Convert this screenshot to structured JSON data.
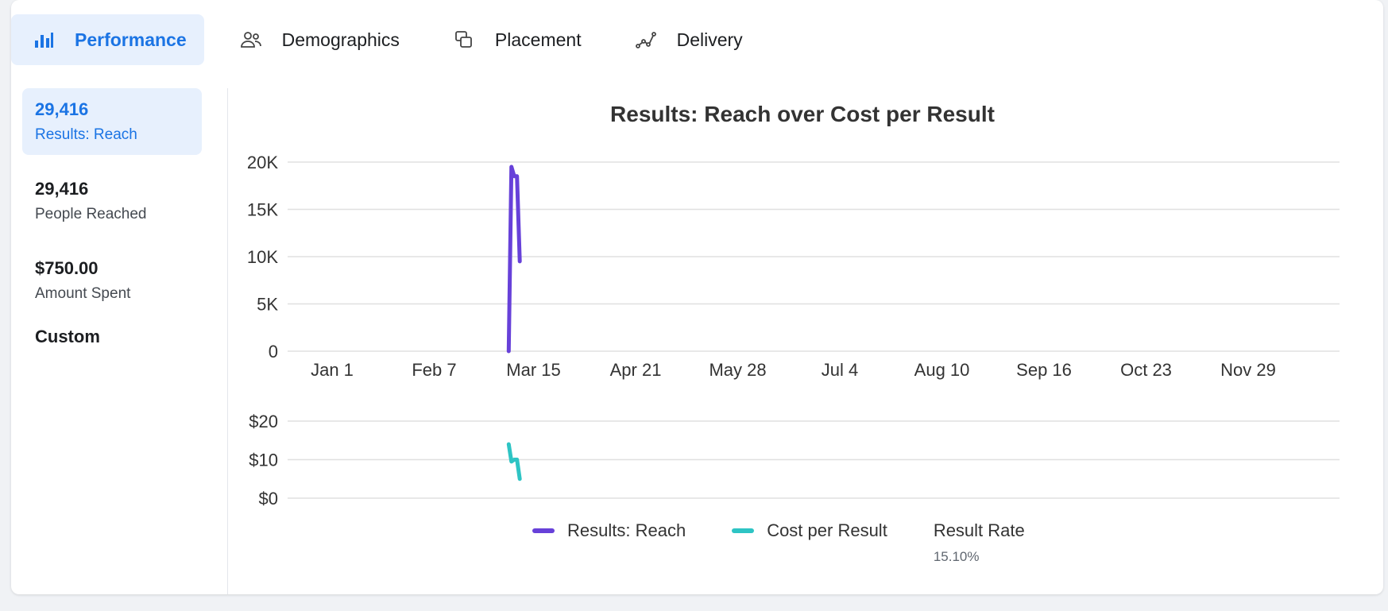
{
  "tabs": [
    {
      "label": "Performance",
      "icon": "bar-chart-icon",
      "active": true
    },
    {
      "label": "Demographics",
      "icon": "people-icon",
      "active": false
    },
    {
      "label": "Placement",
      "icon": "placement-icon",
      "active": false
    },
    {
      "label": "Delivery",
      "icon": "delivery-icon",
      "active": false
    }
  ],
  "metrics": [
    {
      "value": "29,416",
      "label": "Results: Reach",
      "active": true
    },
    {
      "value": "29,416",
      "label": "People Reached",
      "active": false
    },
    {
      "value": "$750.00",
      "label": "Amount Spent",
      "active": false
    }
  ],
  "custom_label": "Custom",
  "legend": {
    "reach_label": "Results: Reach",
    "cost_label": "Cost per Result",
    "rate_label": "Result Rate",
    "rate_value": "15.10%"
  },
  "colors": {
    "accent": "#1b74e4",
    "reach": "#6741d9",
    "cost": "#2ec4c4"
  },
  "chart_data": [
    {
      "type": "line",
      "title": "Results: Reach over Cost per Result",
      "x_ticks": [
        "Jan 1",
        "Feb 7",
        "Mar 15",
        "Apr 21",
        "May 28",
        "Jul 4",
        "Aug 10",
        "Sep 16",
        "Oct 23",
        "Nov 29"
      ],
      "y_ticks": [
        "0",
        "5K",
        "10K",
        "15K",
        "20K"
      ],
      "ylim": [
        0,
        20000
      ],
      "series": [
        {
          "name": "Results: Reach",
          "x": [
            "Mar 6",
            "Mar 7",
            "Mar 8",
            "Mar 9",
            "Mar 10"
          ],
          "values": [
            0,
            19500,
            18500,
            18500,
            9500
          ]
        }
      ]
    },
    {
      "type": "line",
      "x_ticks": [],
      "y_ticks": [
        "$0",
        "$10",
        "$20"
      ],
      "ylim": [
        0,
        20
      ],
      "series": [
        {
          "name": "Cost per Result",
          "x": [
            "Mar 6",
            "Mar 7",
            "Mar 8",
            "Mar 9",
            "Mar 10"
          ],
          "values": [
            14,
            9.5,
            10,
            10,
            5
          ]
        }
      ]
    }
  ]
}
